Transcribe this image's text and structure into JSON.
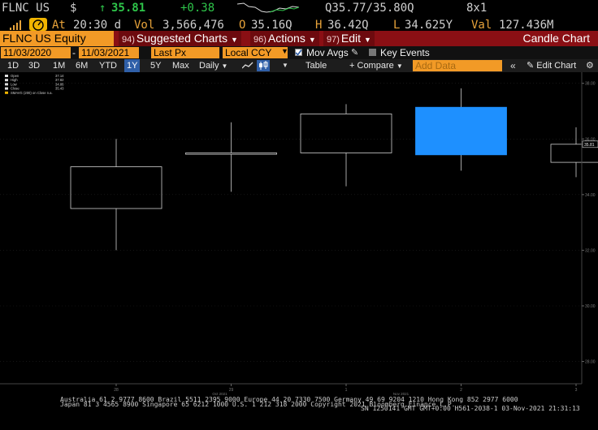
{
  "quote": {
    "ticker": "FLNC US",
    "currency_symbol": "$",
    "arrow": "↑",
    "last": "35.81",
    "change": "+0.38",
    "bid_ask": "Q35.77/35.80Q",
    "size": "8x1",
    "at_label": "At",
    "time": "20:30 d",
    "vol_label": "Vol",
    "volume": "3,566,476",
    "open_label": "O",
    "open": "35.16Q",
    "high_label": "H",
    "high": "36.42Q",
    "low_label": "L",
    "low": "34.625Y",
    "val_label": "Val",
    "value": "127.436M"
  },
  "toolbar": {
    "security": "FLNC US Equity",
    "suggested_num": "94)",
    "suggested": "Suggested Charts",
    "actions_num": "96)",
    "actions": "Actions",
    "edit_num": "97)",
    "edit": "Edit",
    "title": "Candle Chart"
  },
  "settings": {
    "start_date": "11/03/2020",
    "dash": "-",
    "end_date": "11/03/2021",
    "price_field": "Last Px",
    "currency": "Local CCY",
    "mov_avgs": "Mov Avgs",
    "key_events": "Key Events"
  },
  "periods": {
    "items": [
      "1D",
      "3D",
      "1M",
      "6M",
      "YTD",
      "1Y",
      "5Y",
      "Max"
    ],
    "active": "1Y",
    "frequency": "Daily",
    "table": "Table",
    "compare": "Compare",
    "add_data_placeholder": "Add Data",
    "edit_chart": "Edit Chart"
  },
  "legend": {
    "items": [
      {
        "label": "Open",
        "value": "37.14"
      },
      {
        "label": "High",
        "value": "37.82"
      },
      {
        "label": "Low",
        "value": "34.86"
      },
      {
        "label": "Close",
        "value": "35.43"
      },
      {
        "label": "SMAVG (200)",
        "value": "on Close n.a."
      }
    ]
  },
  "chart_data": {
    "type": "candlestick",
    "x_tick_labels": [
      "28",
      "29",
      "1",
      "2",
      "3"
    ],
    "x_month_labels": [
      "Oct 2021",
      "Nov 2021"
    ],
    "y_tick_labels": [
      "38.00",
      "36.00",
      "34.00",
      "32.00",
      "30.00",
      "28.00"
    ],
    "ylim": [
      27.2,
      38.4
    ],
    "last_price_label": "35.81",
    "candles": [
      {
        "x": "28",
        "open": 33.5,
        "high": 36.0,
        "low": 32.0,
        "close": 35.0
      },
      {
        "x": "29",
        "open": 35.5,
        "high": 36.6,
        "low": 34.1,
        "close": 35.45
      },
      {
        "x": "1",
        "open": 35.5,
        "high": 37.25,
        "low": 34.3,
        "close": 36.9
      },
      {
        "x": "2",
        "open": 37.14,
        "high": 37.82,
        "low": 34.86,
        "close": 35.43
      },
      {
        "x": "3",
        "open": 35.16,
        "high": 36.42,
        "low": 34.625,
        "close": 35.81
      }
    ],
    "highlighted": "2",
    "colors": {
      "highlight": "#1e90ff",
      "outline": "#cfcfcf",
      "grid": "#222222",
      "axis_text": "#7a7a7a"
    }
  },
  "footer": {
    "line1": "Australia 61 2 9777 8600 Brazil 5511 2395 9000 Europe 44 20 7330 7500 Germany 49 69 9204 1210 Hong Kong 852 2977 6000",
    "line2": "Japan 81 3 4565 8900       Singapore 65 6212 1000     U.S. 1 212 318 2000        Copyright 2021 Bloomberg Finance L.P.",
    "line3": "SN 1250141 GMT  GMT+0:00 H561-2038-1 03-Nov-2021 21:31:13"
  }
}
